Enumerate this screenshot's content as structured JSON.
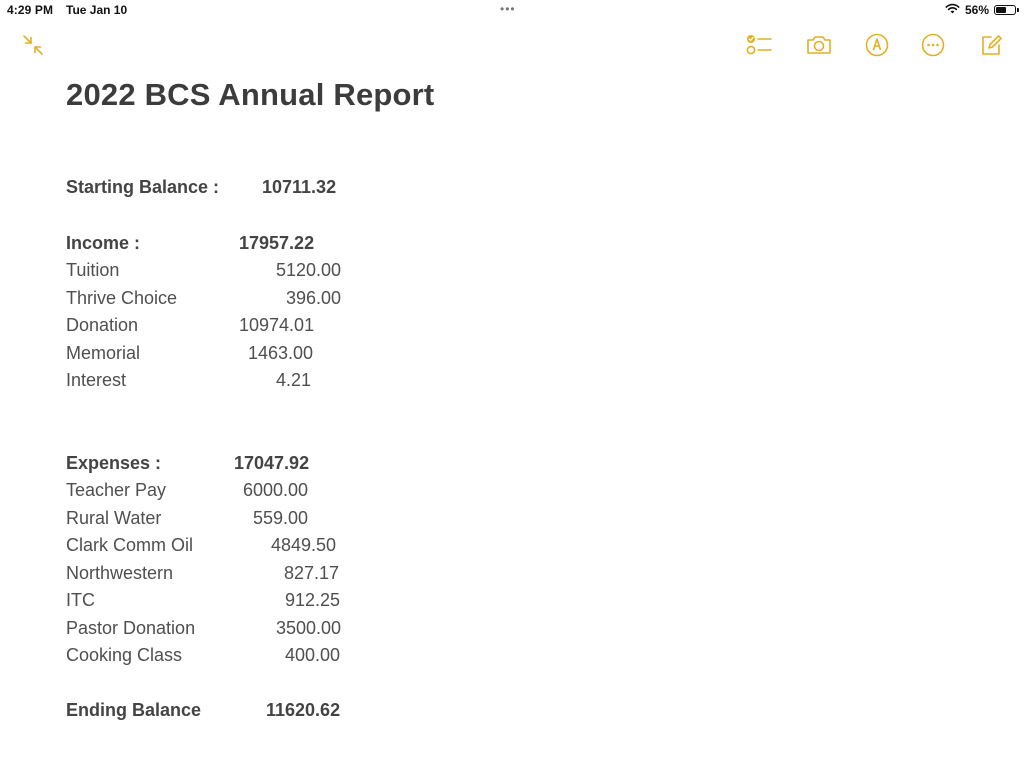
{
  "status_bar": {
    "time": "4:29 PM",
    "date": "Tue Jan 10",
    "multitask_dots": "•••",
    "battery_percent": "56%",
    "battery_level": 0.56
  },
  "toolbar": {
    "left_icon": "collapse-arrows-icon",
    "right_icons": [
      "checklist-icon",
      "camera-icon",
      "markup-pen-icon",
      "more-ellipsis-icon",
      "compose-icon"
    ],
    "accent_color": "#E3B024"
  },
  "note": {
    "title": "2022 BCS Annual Report",
    "starting_balance": {
      "label": "Starting Balance :",
      "value": "10711.32"
    },
    "income": {
      "label": "Income :",
      "total": "17957.22",
      "items": [
        {
          "label": "Tuition",
          "value": "5120.00"
        },
        {
          "label": "Thrive Choice",
          "value": "396.00"
        },
        {
          "label": "Donation",
          "value": "10974.01"
        },
        {
          "label": "Memorial",
          "value": "1463.00"
        },
        {
          "label": "Interest",
          "value": "4.21"
        }
      ]
    },
    "expenses": {
      "label": "Expenses :",
      "total": "17047.92",
      "items": [
        {
          "label": "Teacher Pay",
          "value": "6000.00"
        },
        {
          "label": "Rural Water",
          "value": "559.00"
        },
        {
          "label": "Clark Comm Oil",
          "value": "4849.50"
        },
        {
          "label": "Northwestern",
          "value": "827.17"
        },
        {
          "label": "ITC",
          "value": "912.25"
        },
        {
          "label": "Pastor Donation",
          "value": "3500.00"
        },
        {
          "label": "Cooking Class",
          "value": "400.00"
        }
      ]
    },
    "ending_balance": {
      "label": "Ending Balance",
      "value": "11620.62"
    }
  }
}
